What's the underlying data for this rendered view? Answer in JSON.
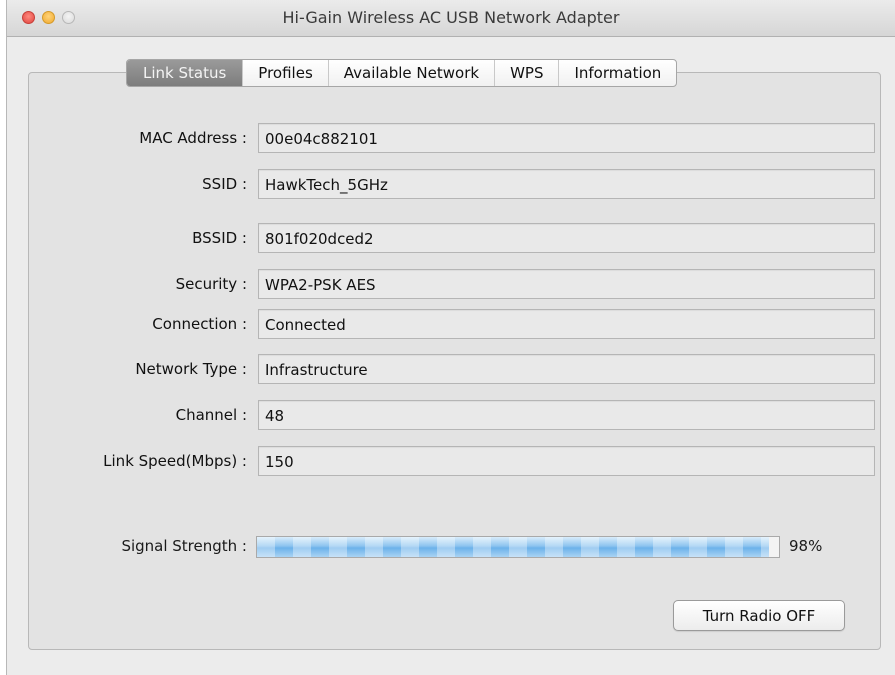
{
  "window": {
    "title": "Hi-Gain Wireless AC USB Network Adapter"
  },
  "tabs": [
    {
      "label": "Link Status",
      "active": true
    },
    {
      "label": "Profiles",
      "active": false
    },
    {
      "label": "Available Network",
      "active": false
    },
    {
      "label": "WPS",
      "active": false
    },
    {
      "label": "Information",
      "active": false
    }
  ],
  "fields": {
    "mac_address": {
      "label": "MAC Address :",
      "value": "00e04c882101"
    },
    "ssid": {
      "label": "SSID :",
      "value": "HawkTech_5GHz"
    },
    "bssid": {
      "label": "BSSID :",
      "value": "801f020dced2"
    },
    "security": {
      "label": "Security :",
      "value": "WPA2-PSK AES"
    },
    "connection": {
      "label": "Connection :",
      "value": "Connected"
    },
    "network_type": {
      "label": "Network Type :",
      "value": "Infrastructure"
    },
    "channel": {
      "label": "Channel :",
      "value": "48"
    },
    "link_speed": {
      "label": "Link Speed(Mbps) :",
      "value": "150"
    }
  },
  "signal": {
    "label": "Signal Strength :",
    "percent_text": "98%",
    "level": 0.98
  },
  "radio_button": {
    "label": "Turn Radio OFF"
  },
  "colors": {
    "signal_fill": "#7dbbec",
    "active_tab": "#8a8a8a"
  }
}
